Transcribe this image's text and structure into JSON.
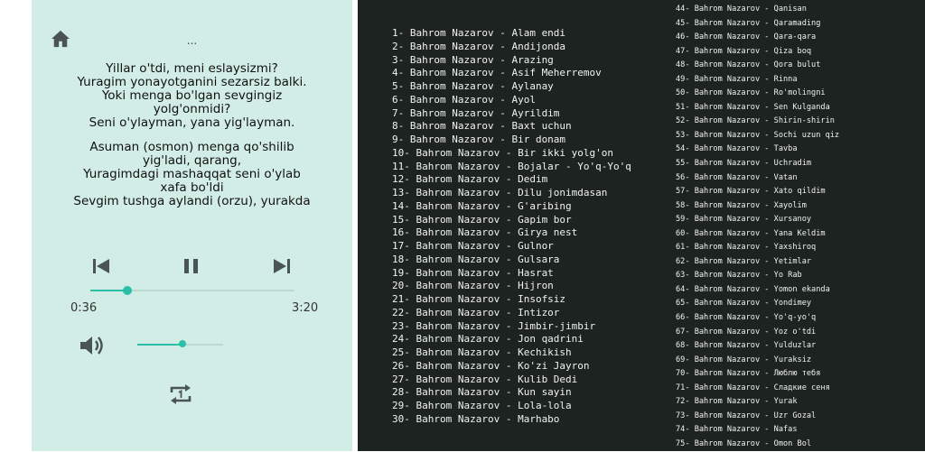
{
  "lyrics": {
    "cut_line": "...",
    "stanzas": [
      [
        "Yillar o'tdi, meni eslaysizmi?",
        "Yuragim yonayotganini sezarsiz balki.",
        "Yoki menga bo'lgan sevgingiz",
        "yolg'onmidi?",
        "Seni o'ylayman, yana yig'layman."
      ],
      [
        "Asuman (osmon) menga qo'shilib",
        "yig'ladi, qarang,",
        "Yuragimdagi mashaqqat seni o'ylab",
        "xafa bo'ldi",
        "Sevgim tushga aylandi (orzu), yurakda"
      ]
    ]
  },
  "player": {
    "elapsed": "0:36",
    "duration": "3:20",
    "progress": 0.18,
    "volume": 0.53,
    "icons": [
      "home-icon",
      "previous-icon",
      "pause-icon",
      "next-icon",
      "volume-icon",
      "repeat-one-icon"
    ],
    "accent": "#2bbfa8"
  },
  "songs_left": [
    "1- Bahrom Nazarov - Alam endi",
    "2- Bahrom Nazarov - Andijonda",
    "3- Bahrom Nazarov - Arazing",
    "4- Bahrom Nazarov - Asif Meherremov",
    "5- Bahrom Nazarov - Aylanay",
    "6- Bahrom Nazarov - Ayol",
    "7- Bahrom Nazarov - Ayrildim",
    "8- Bahrom Nazarov - Baxt uchun",
    "9- Bahrom Nazarov - Bir donam",
    "10- Bahrom Nazarov - Bir ikki yolg'on",
    "11- Bahrom Nazarov - Bojalar - Yo'q-Yo'q",
    "12- Bahrom Nazarov - Dedim",
    "13- Bahrom Nazarov - Dilu jonimdasan",
    "14- Bahrom Nazarov - G'aribing",
    "15- Bahrom Nazarov - Gapim bor",
    "16- Bahrom Nazarov - Girya nest",
    "17- Bahrom Nazarov - Gulnor",
    "18- Bahrom Nazarov - Gulsara",
    "19- Bahrom Nazarov - Hasrat",
    "20- Bahrom Nazarov - Hijron",
    "21- Bahrom Nazarov - Insofsiz",
    "22- Bahrom Nazarov - Intizor",
    "23- Bahrom Nazarov - Jimbir-jimbir",
    "24- Bahrom Nazarov - Jon qadrini",
    "25- Bahrom Nazarov - Kechikish",
    "26- Bahrom Nazarov - Ko'zi Jayron",
    "27- Bahrom Nazarov - Kulib Dedi",
    "28- Bahrom Nazarov - Kun sayin",
    "29- Bahrom Nazarov - Lola-lola",
    "30- Bahrom Nazarov - Marhabo"
  ],
  "songs_right": [
    "44- Bahrom Nazarov - Qanisan",
    "45- Bahrom Nazarov - Qaramading",
    "46- Bahrom Nazarov - Qara-qara",
    "47- Bahrom Nazarov - Qiza boq",
    "48- Bahrom Nazarov - Qora bulut",
    "49- Bahrom Nazarov - Rinna",
    "50- Bahrom Nazarov - Ro'molingni",
    "51- Bahrom Nazarov - Sen Kulganda",
    "52- Bahrom Nazarov - Shirin-shirin",
    "53- Bahrom Nazarov - Sochi uzun qiz",
    "54- Bahrom Nazarov - Tavba",
    "55- Bahrom Nazarov - Uchradim",
    "56- Bahrom Nazarov - Vatan",
    "57- Bahrom Nazarov - Xato qildim",
    "58- Bahrom Nazarov - Xayolim",
    "59- Bahrom Nazarov - Xursanoy",
    "60- Bahrom Nazarov - Yana Keldim",
    "61- Bahrom Nazarov - Yaxshiroq",
    "62- Bahrom Nazarov - Yetimlar",
    "63- Bahrom Nazarov - Yo Rab",
    "64- Bahrom Nazarov - Yomon ekanda",
    "65- Bahrom Nazarov - Yondimey",
    "66- Bahrom Nazarov - Yo'q-yo'q",
    "67- Bahrom Nazarov - Yoz o'tdi",
    "68- Bahrom Nazarov - Yulduzlar",
    "69- Bahrom Nazarov - Yuraksiz",
    "70- Bahrom Nazarov - Люблю тебя",
    "71- Bahrom Nazarov - Сладкие сеня",
    "72- Bahrom Nazarov - Yurak",
    "73- Bahrom Nazarov - Uzr Gozal",
    "74- Bahrom Nazarov - Nafas",
    "75- Bahrom Nazarov - Omon Bol"
  ]
}
